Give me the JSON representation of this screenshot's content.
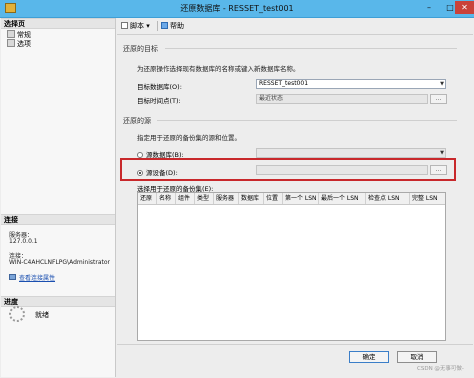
{
  "window": {
    "title": "还原数据库 - RESSET_test001",
    "controls": {
      "minimize": "–",
      "maximize": "□",
      "close": "✕"
    }
  },
  "sidebar": {
    "select_page_header": "选择页",
    "pages": [
      {
        "label": "常规",
        "icon": "page-icon"
      },
      {
        "label": "选项",
        "icon": "page-icon"
      }
    ],
    "connection_header": "连接",
    "server_label": "服务器：",
    "server_value": "127.0.0.1",
    "connection_label": "连接：",
    "connection_value": "WIN-C4AHCLNFLPG\\Administrator",
    "view_connection_link": "查看连接属性",
    "progress_header": "进度",
    "progress_status": "就绪"
  },
  "toolbar": {
    "script_label": "脚本",
    "script_arrow": "▾",
    "help_label": "帮助"
  },
  "restore_target": {
    "section_title": "还原的目标",
    "description": "为还原操作选择现有数据库的名称或键入新数据库名称。",
    "target_db_label": "目标数据库(O):",
    "target_db_value": "RESSET_test001",
    "target_time_label": "目标时间点(T):",
    "target_time_value": "最近状态",
    "dots": "..."
  },
  "restore_source": {
    "section_title": "还原的源",
    "description": "指定用于还原的备份集的源和位置。",
    "from_database_label": "源数据库(B):",
    "from_device_label": "源设备(D):",
    "selected": "from_device",
    "dots": "..."
  },
  "backup_sets": {
    "label": "选择用于还原的备份集(E):",
    "columns": [
      "还原",
      "名称",
      "组件",
      "类型",
      "服务器",
      "数据库",
      "位置",
      "第一个 LSN",
      "最后一个 LSN",
      "检查点 LSN",
      "完整 LSN"
    ],
    "rows": []
  },
  "buttons": {
    "ok": "确定",
    "cancel": "取消"
  },
  "watermark": "CSDN @无事可做-"
}
